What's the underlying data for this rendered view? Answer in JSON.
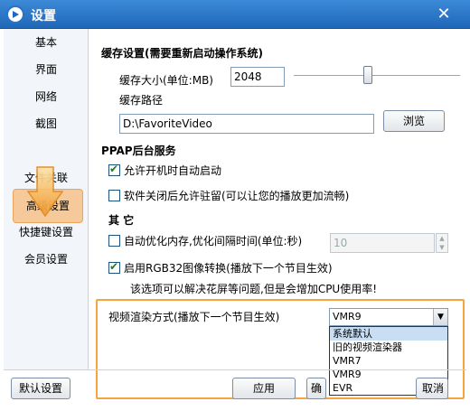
{
  "window": {
    "title": "设置",
    "close": "✕"
  },
  "nav": {
    "items": [
      {
        "label": "基本"
      },
      {
        "label": "界面"
      },
      {
        "label": "网络"
      },
      {
        "label": "截图"
      },
      {
        "label": "文件关联"
      },
      {
        "label": "高级设置",
        "active": true
      },
      {
        "label": "快捷键设置"
      },
      {
        "label": "会员设置"
      }
    ]
  },
  "cache": {
    "title": "缓存设置(需要重新启动操作系统)",
    "size_label": "缓存大小(单位:MB)",
    "size_value": "2048",
    "path_label": "缓存路径",
    "path_value": "D:\\FavoriteVideo",
    "browse_label": "浏览"
  },
  "ppap": {
    "title": "PPAP后台服务",
    "autostart_label": "允许开机时自动启动",
    "autostart_checked": true,
    "resident_label": "软件关闭后允许驻留(可以让您的播放更加流畅)",
    "resident_checked": false
  },
  "other": {
    "title": "其  它",
    "optimize_label": "自动优化内存,优化间隔时间(单位:秒)",
    "optimize_checked": false,
    "optimize_value": "10",
    "rgb_label": "启用RGB32图像转换(播放下一个节目生效)",
    "rgb_checked": true,
    "rgb_note": "该选项可以解决花屏等问题,但是会增加CPU使用率!"
  },
  "render": {
    "label": "视频渲染方式(播放下一个节目生效)",
    "selected": "VMR9",
    "options": [
      "系统默认",
      "旧的视频渲染器",
      "VMR7",
      "VMR9",
      "EVR"
    ],
    "highlighted_index": 0
  },
  "footer": {
    "default_label": "默认设置",
    "apply_label": "应用",
    "ok_label": "确定",
    "cancel_label": "取消"
  },
  "colors": {
    "titlebar": "#2b72c4",
    "active_nav": "#f5c99a",
    "highlight_border": "#f5a540",
    "arrow": "#f5a540"
  }
}
